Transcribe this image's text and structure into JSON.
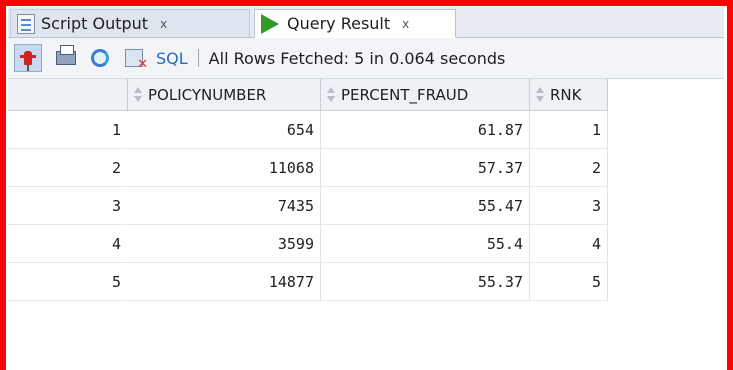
{
  "tabs": [
    {
      "label": "Script Output",
      "close": "x"
    },
    {
      "label": "Query Result",
      "close": "x"
    }
  ],
  "toolbar": {
    "sql_label": "SQL",
    "separator": "|",
    "status": "All Rows Fetched: 5 in 0.064 seconds"
  },
  "grid": {
    "columns": [
      "POLICYNUMBER",
      "PERCENT_FRAUD",
      "RNK"
    ],
    "rows": [
      {
        "num": "1",
        "policynumber": "654",
        "percent_fraud": "61.87",
        "rnk": "1"
      },
      {
        "num": "2",
        "policynumber": "11068",
        "percent_fraud": "57.37",
        "rnk": "2"
      },
      {
        "num": "3",
        "policynumber": "7435",
        "percent_fraud": "55.47",
        "rnk": "3"
      },
      {
        "num": "4",
        "policynumber": "3599",
        "percent_fraud": "55.4",
        "rnk": "4"
      },
      {
        "num": "5",
        "policynumber": "14877",
        "percent_fraud": "55.37",
        "rnk": "5"
      }
    ]
  },
  "colors": {
    "highlight_border": "#ff0000",
    "run_icon": "#2f9c26",
    "sql_link": "#2a6ac0"
  },
  "icons": [
    "script-output-icon",
    "run-query-icon",
    "pin-icon",
    "print-icon",
    "refresh-icon",
    "cancel-query-icon",
    "sort-icon"
  ]
}
